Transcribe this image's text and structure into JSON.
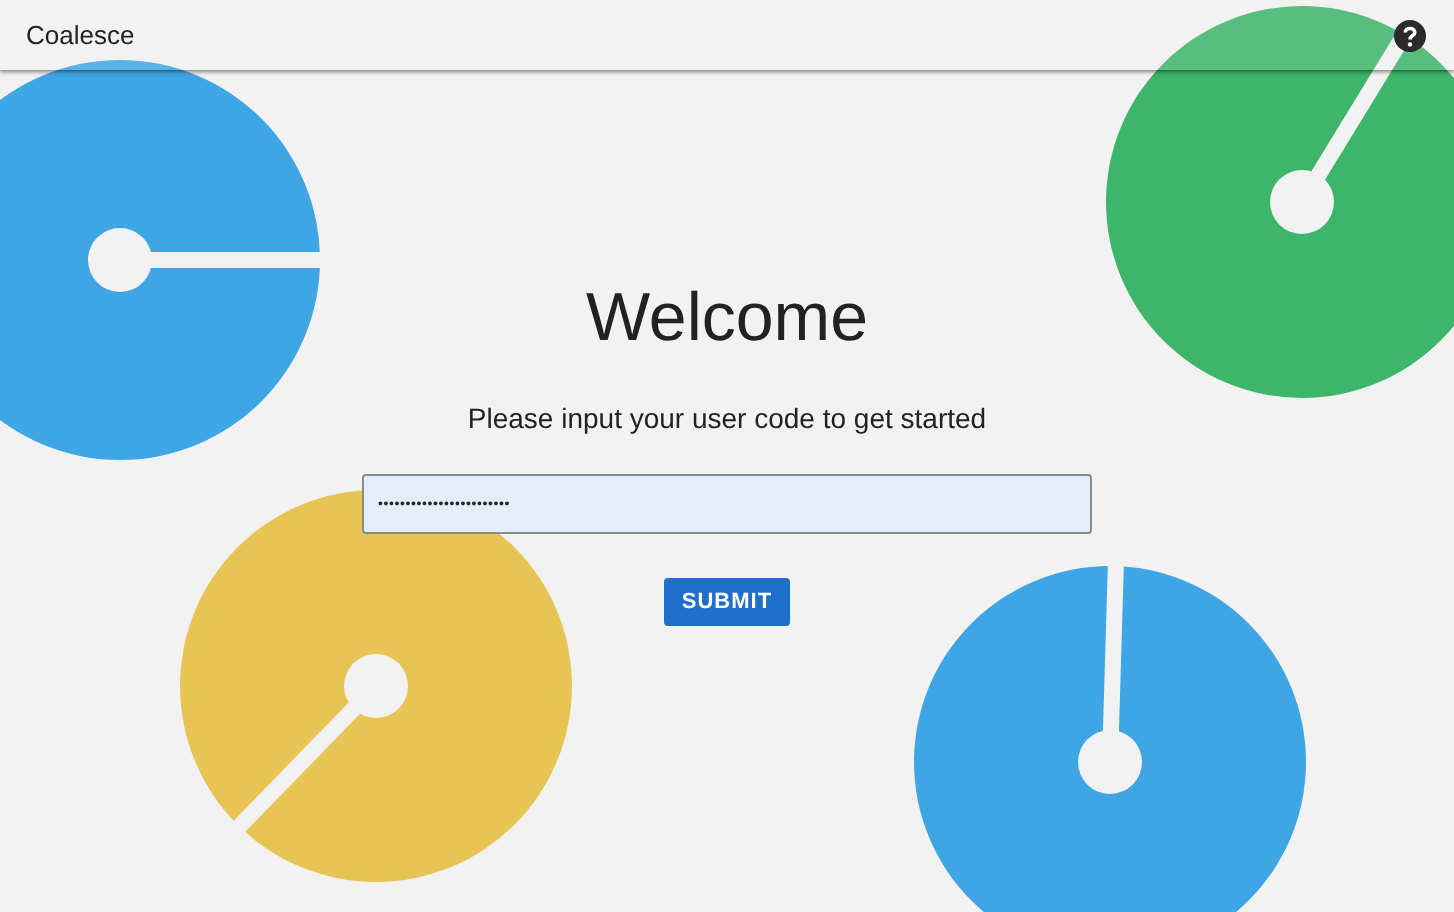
{
  "header": {
    "title": "Coalesce"
  },
  "welcome": {
    "heading": "Welcome",
    "prompt": "Please input your user code to get started"
  },
  "code_field": {
    "value": "••••••••••••••••••••••••"
  },
  "submit_button": {
    "label": "SUBMIT"
  }
}
